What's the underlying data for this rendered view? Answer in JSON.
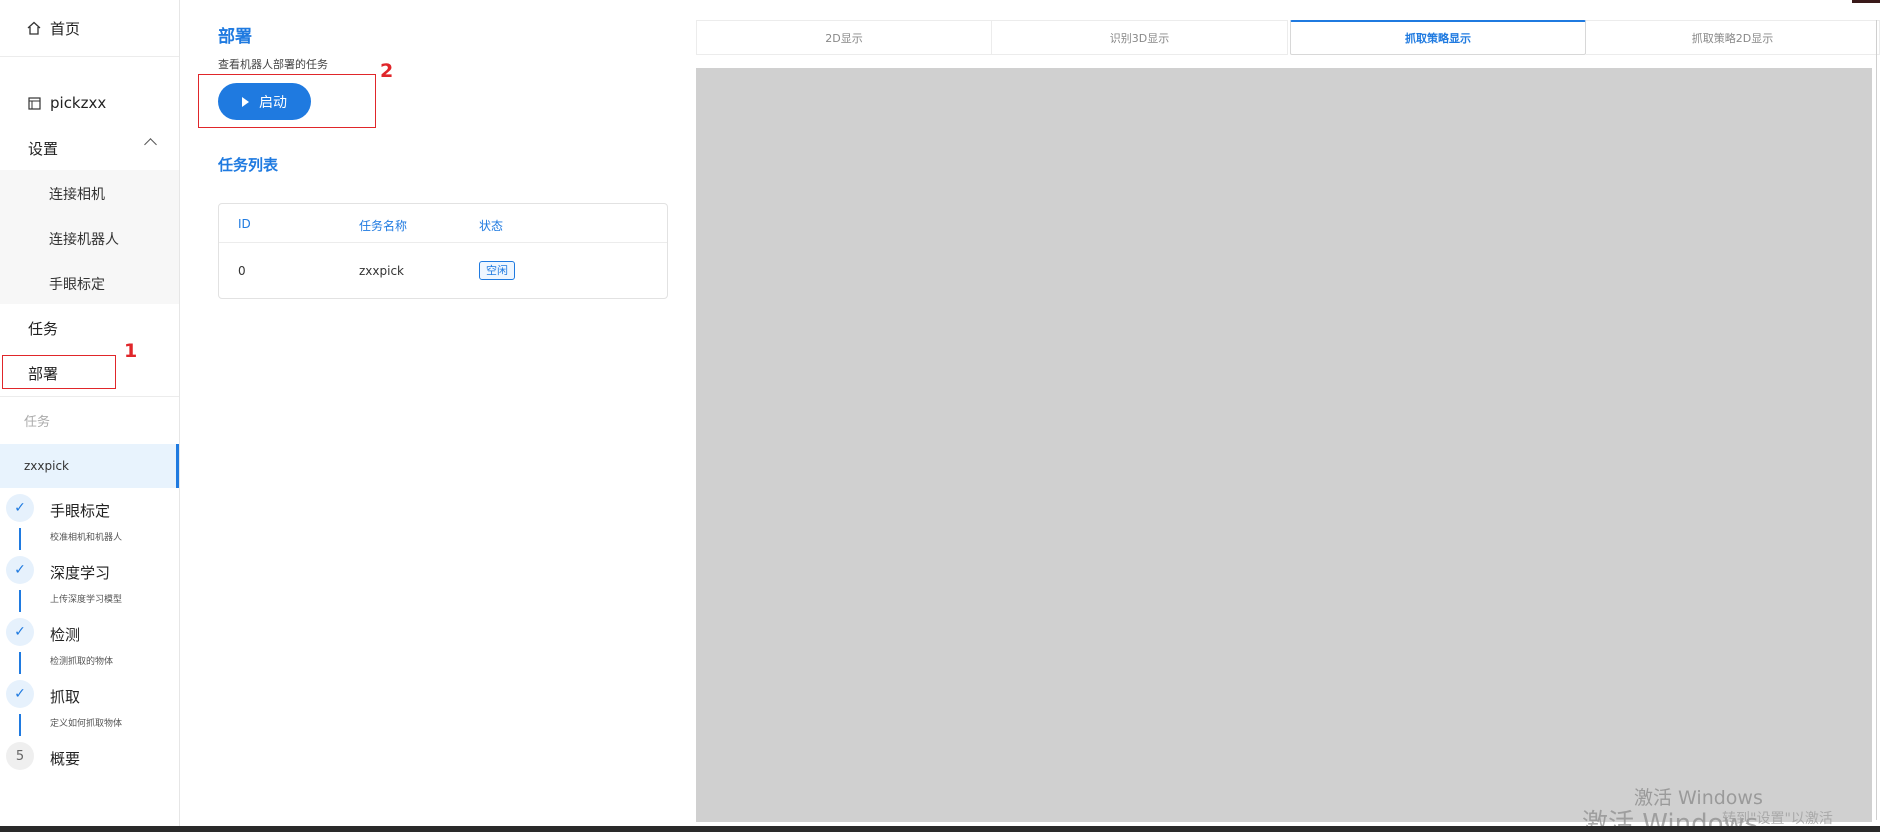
{
  "sidebar": {
    "home_label": "首页",
    "project_label": "pickzxx",
    "settings_label": "设置",
    "settings_items": [
      "连接相机",
      "连接机器人",
      "手眼标定"
    ],
    "task_label": "任务",
    "deploy_label": "部署",
    "task_section_label": "任务",
    "task_entry": "zxxpick",
    "steps": [
      {
        "title": "手眼标定",
        "desc": "校准相机和机器人",
        "done": true
      },
      {
        "title": "深度学习",
        "desc": "上传深度学习模型",
        "done": true
      },
      {
        "title": "检测",
        "desc": "检测抓取的物体",
        "done": true
      },
      {
        "title": "抓取",
        "desc": "定义如何抓取物体",
        "done": true
      },
      {
        "title": "概要",
        "desc": "",
        "done": false,
        "number": "5"
      }
    ]
  },
  "annotations": {
    "one": "1",
    "two": "2"
  },
  "main": {
    "title": "部署",
    "description": "查看机器人部署的任务",
    "start_label": "启动",
    "list_title": "任务列表",
    "table": {
      "headers": [
        "ID",
        "任务名称",
        "状态"
      ],
      "rows": [
        {
          "id": "0",
          "name": "zxxpick",
          "status": "空闲"
        }
      ]
    }
  },
  "tabs": [
    "2D显示",
    "识别3D显示",
    "抓取策略显示",
    "抓取策略2D显示"
  ],
  "active_tab": "抓取策略显示",
  "watermark": {
    "line1": "激活 Windows",
    "line2": "激活 Windows",
    "line3": "转到\"设置\"以激活 Windows。"
  },
  "colors": {
    "accent": "#1f7ae0",
    "annotation": "#e0262a",
    "canvas": "#d0d0d0"
  }
}
